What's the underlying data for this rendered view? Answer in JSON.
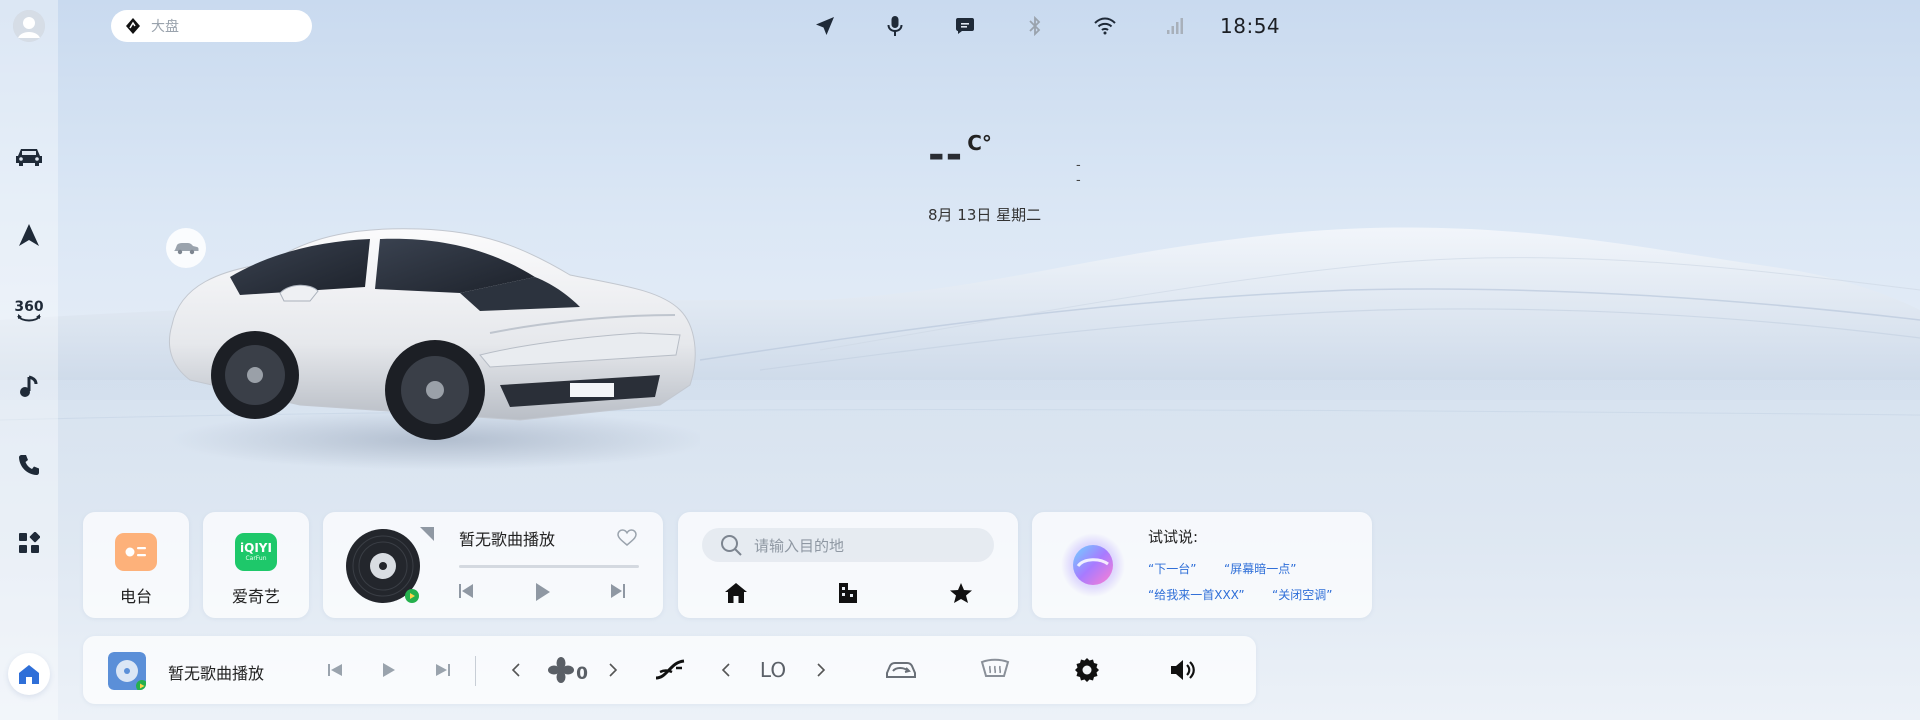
{
  "topbar": {
    "search_text": "大盘",
    "clock": "18:54",
    "status_icons": [
      "navigation-icon",
      "microphone-icon",
      "message-icon",
      "bluetooth-icon",
      "wifi-icon",
      "signal-icon"
    ]
  },
  "sidebar": {
    "items": [
      "car-icon",
      "navigation-icon",
      "camera-360-icon",
      "music-icon",
      "phone-icon",
      "apps-icon"
    ],
    "label_360": "360",
    "home": "home-icon"
  },
  "weather": {
    "temperature": "--",
    "unit": "C°",
    "aqi": "--",
    "date": "8月 13日 星期二"
  },
  "apps": [
    {
      "label": "电台",
      "icon": "radio-icon",
      "color": "#fdb17a"
    },
    {
      "label": "爱奇艺",
      "icon": "iqiyi-icon",
      "color": "#1ec86a",
      "logo_text": "iQIYI",
      "sub_text": "CarFun"
    }
  ],
  "music": {
    "title": "暂无歌曲播放",
    "progress": 0
  },
  "navigation": {
    "placeholder": "请输入目的地",
    "shortcuts": [
      "home-icon",
      "company-icon",
      "favorite-icon"
    ]
  },
  "voice": {
    "title": "试试说:",
    "hints": [
      "“下一台”",
      "“屏幕暗一点”",
      "“给我来一首XXX”",
      "“关闭空调”"
    ]
  },
  "dock": {
    "title": "暂无歌曲播放",
    "fan_level": "0",
    "temperature": "LO"
  },
  "colors": {
    "accent": "#2f6fd8",
    "home_active": "#2f6fd8"
  }
}
